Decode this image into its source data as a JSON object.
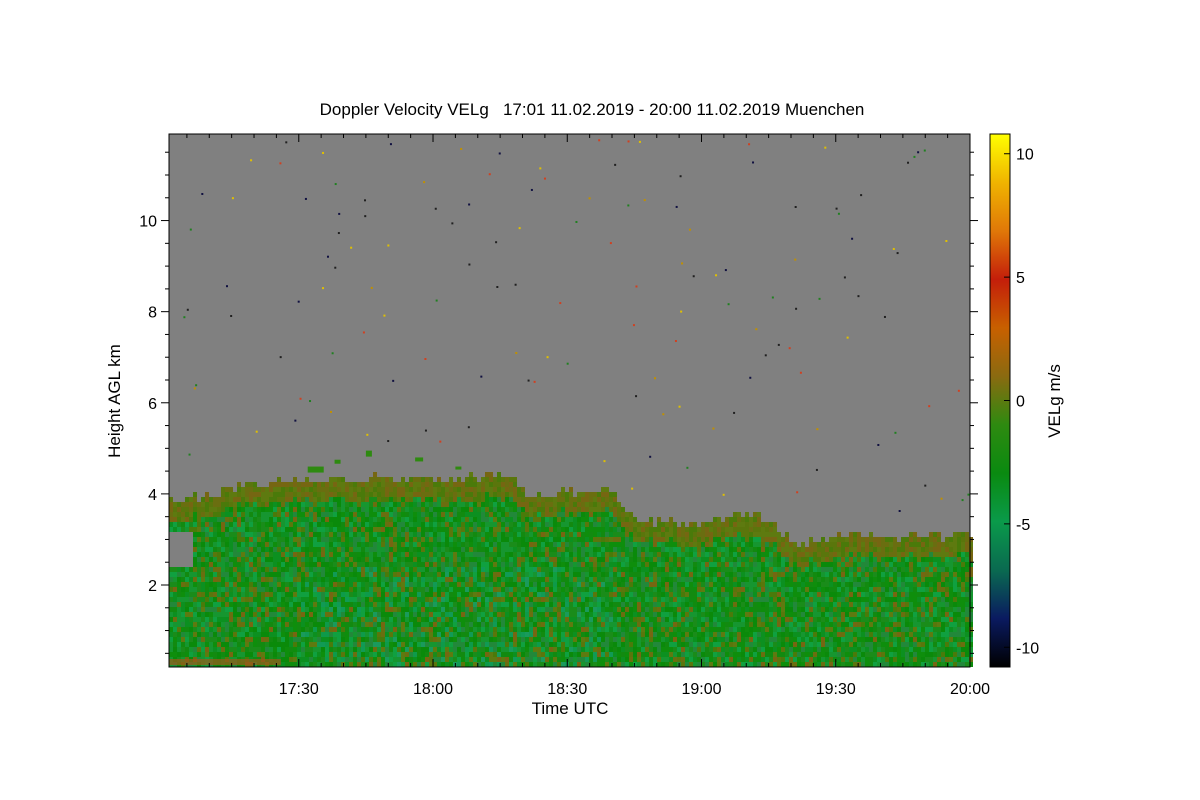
{
  "chart_data": {
    "type": "heatmap",
    "title": "Doppler Velocity VELg   17:01 11.02.2019 - 20:00 11.02.2019 Muenchen",
    "xlabel": "Time UTC",
    "ylabel": "Height AGL km",
    "x_ticks": [
      "17:30",
      "18:00",
      "18:30",
      "19:00",
      "19:30",
      "20:00"
    ],
    "y_ticks": [
      "2",
      "4",
      "6",
      "8",
      "10"
    ],
    "colorbar": {
      "label": "VELg m/s",
      "ticks": [
        "-10",
        "-5",
        "0",
        "5",
        "10"
      ],
      "range": [
        -10.8,
        10.8
      ],
      "colors": [
        "#000000",
        "#0a1a60",
        "#0a6a50",
        "#0a9a4a",
        "#0a8a10",
        "#2e8a10",
        "#8a6a10",
        "#c86000",
        "#c41e0a",
        "#e07808",
        "#f0b400",
        "#ffff00"
      ]
    },
    "x_range_minutes": [
      1021,
      1200
    ],
    "x_start": "17:01",
    "x_end": "20:00",
    "ylim": [
      0.2,
      11.9
    ],
    "background_color": "#808080",
    "cloud_top_km": [
      {
        "time": "17:01",
        "top": 3.8
      },
      {
        "time": "17:10",
        "top": 3.95
      },
      {
        "time": "17:15",
        "top": 4.1
      },
      {
        "time": "17:30",
        "top": 4.25
      },
      {
        "time": "17:45",
        "top": 4.3
      },
      {
        "time": "18:00",
        "top": 4.25
      },
      {
        "time": "18:15",
        "top": 4.4
      },
      {
        "time": "18:22",
        "top": 3.9
      },
      {
        "time": "18:30",
        "top": 4.0
      },
      {
        "time": "18:40",
        "top": 4.05
      },
      {
        "time": "18:45",
        "top": 3.4
      },
      {
        "time": "19:00",
        "top": 3.25
      },
      {
        "time": "19:10",
        "top": 3.55
      },
      {
        "time": "19:15",
        "top": 3.3
      },
      {
        "time": "19:20",
        "top": 2.85
      },
      {
        "time": "19:30",
        "top": 3.05
      },
      {
        "time": "19:45",
        "top": 3.0
      },
      {
        "time": "20:00",
        "top": 3.05
      }
    ],
    "gap_region": {
      "time_start": "17:01",
      "time_end": "17:06",
      "height_start": 2.4,
      "height_end": 3.2
    }
  }
}
